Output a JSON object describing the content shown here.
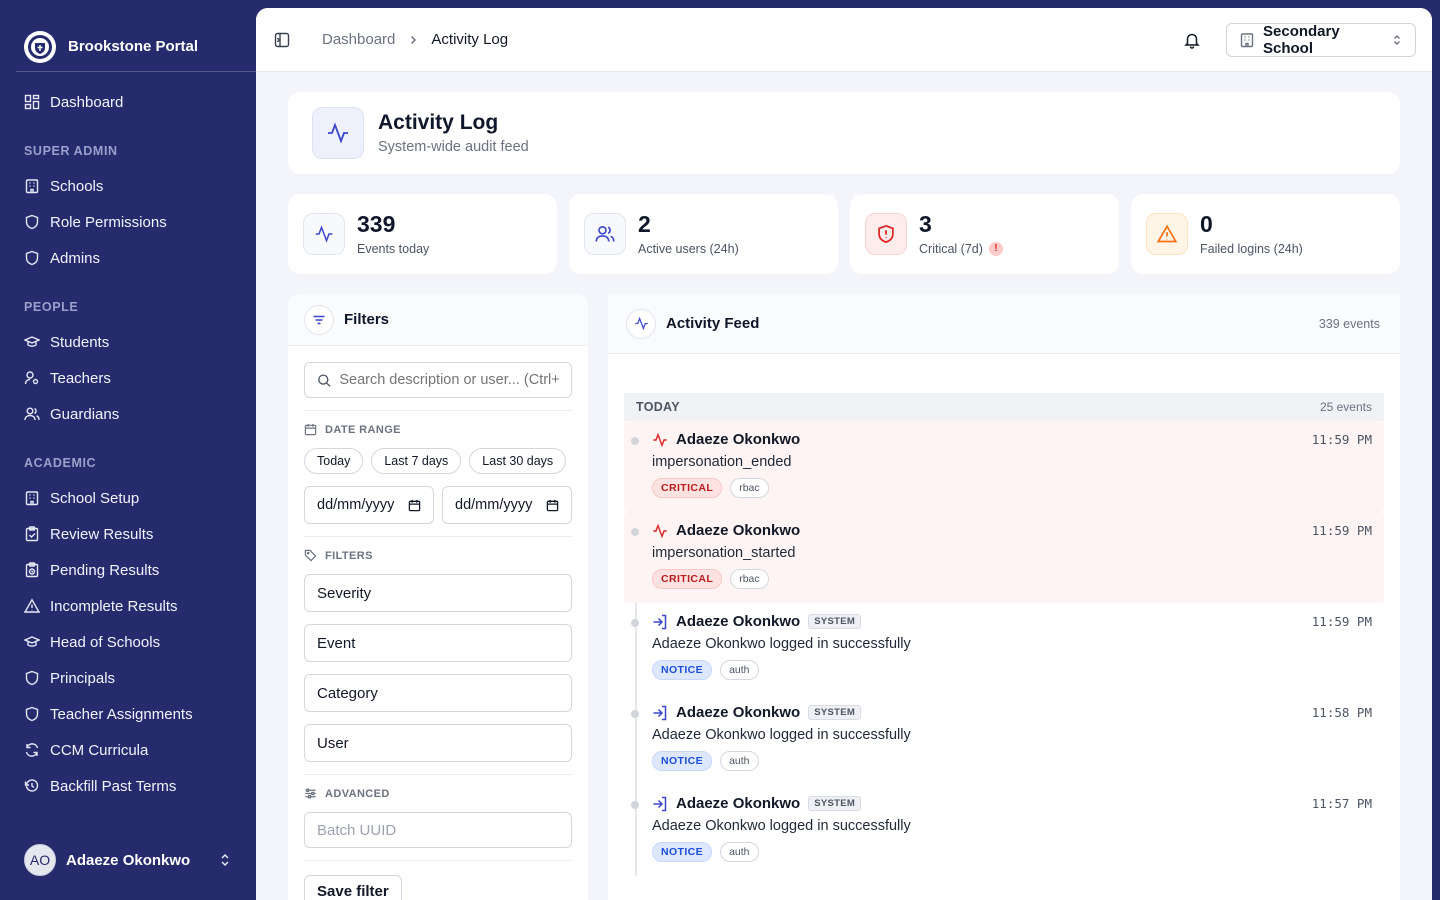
{
  "app": {
    "name": "Brookstone Portal"
  },
  "sidebar": {
    "dashboard": "Dashboard",
    "sections": [
      {
        "title": "SUPER ADMIN",
        "items": [
          "Schools",
          "Role Permissions",
          "Admins"
        ]
      },
      {
        "title": "PEOPLE",
        "items": [
          "Students",
          "Teachers",
          "Guardians"
        ]
      },
      {
        "title": "ACADEMIC",
        "items": [
          "School Setup",
          "Review Results",
          "Pending Results",
          "Incomplete Results",
          "Head of Schools",
          "Principals",
          "Teacher Assignments",
          "CCM Curricula",
          "Backfill Past Terms"
        ]
      }
    ],
    "user": {
      "initials": "AO",
      "name": "Adaeze Okonkwo"
    }
  },
  "topbar": {
    "breadcrumb": [
      "Dashboard",
      "Activity Log"
    ],
    "school": "Secondary School"
  },
  "header": {
    "title": "Activity Log",
    "subtitle": "System-wide audit feed"
  },
  "stats": [
    {
      "value": "339",
      "label": "Events today",
      "icon": "activity-icon"
    },
    {
      "value": "2",
      "label": "Active users (24h)",
      "icon": "users-icon"
    },
    {
      "value": "3",
      "label": "Critical (7d)",
      "icon": "shield-alert-icon",
      "badge": "!"
    },
    {
      "value": "0",
      "label": "Failed logins (24h)",
      "icon": "warning-triangle-icon"
    }
  ],
  "filters": {
    "title": "Filters",
    "search_placeholder": "Search description or user... (Ctrl+K)",
    "date_range_label": "DATE RANGE",
    "quick_ranges": [
      "Today",
      "Last 7 days",
      "Last 30 days"
    ],
    "date_placeholder": "dd/mm/yyyy",
    "filters_label": "FILTERS",
    "selects": [
      "Severity",
      "Event",
      "Category",
      "User"
    ],
    "advanced_label": "ADVANCED",
    "batch_placeholder": "Batch UUID",
    "save_label": "Save filter"
  },
  "feed": {
    "title": "Activity Feed",
    "count": "339 events",
    "group": {
      "title": "TODAY",
      "count": "25 events"
    },
    "events": [
      {
        "user": "Adaeze Okonkwo",
        "system": false,
        "time": "11:59 PM",
        "desc": "impersonation_ended",
        "severity": "CRITICAL",
        "category": "rbac"
      },
      {
        "user": "Adaeze Okonkwo",
        "system": false,
        "time": "11:59 PM",
        "desc": "impersonation_started",
        "severity": "CRITICAL",
        "category": "rbac"
      },
      {
        "user": "Adaeze Okonkwo",
        "system": true,
        "system_label": "SYSTEM",
        "time": "11:59 PM",
        "desc": "Adaeze Okonkwo logged in successfully",
        "severity": "NOTICE",
        "category": "auth"
      },
      {
        "user": "Adaeze Okonkwo",
        "system": true,
        "system_label": "SYSTEM",
        "time": "11:58 PM",
        "desc": "Adaeze Okonkwo logged in successfully",
        "severity": "NOTICE",
        "category": "auth"
      },
      {
        "user": "Adaeze Okonkwo",
        "system": true,
        "system_label": "SYSTEM",
        "time": "11:57 PM",
        "desc": "Adaeze Okonkwo logged in successfully",
        "severity": "NOTICE",
        "category": "auth"
      }
    ]
  },
  "colors": {
    "sidebar": "#262b6e",
    "accent": "#3b46c9",
    "critical": "#dc2626",
    "notice": "#1d4ed8"
  }
}
